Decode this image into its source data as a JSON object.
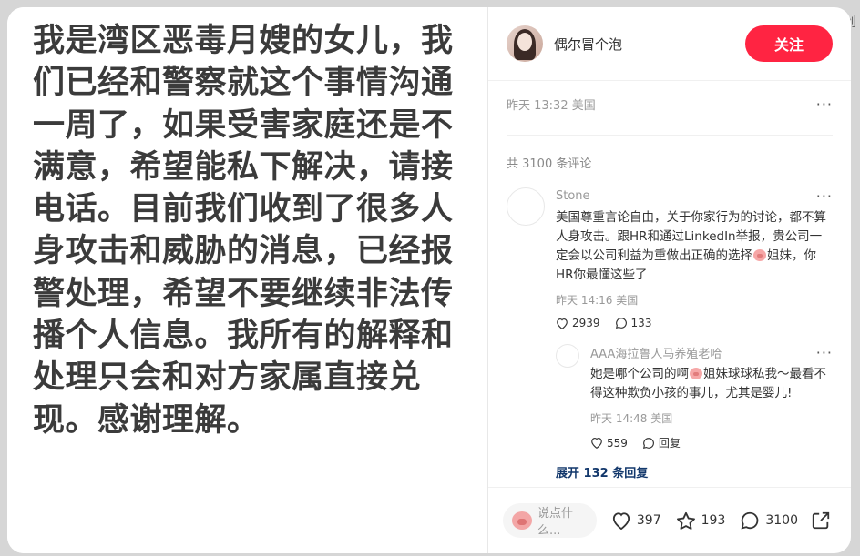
{
  "corner_text": "创",
  "post": {
    "body": "我是湾区恶毒月嫂的女儿，我们已经和警察就这个事情沟通一周了，如果受害家庭还是不满意，希望能私下解决，请接电话。目前我们收到了很多人身攻击和威胁的消息，已经报警处理，希望不要继续非法传播个人信息。我所有的解释和处理只会和对方家属直接兑现。感谢理解。"
  },
  "author": {
    "name": "偶尔冒个泡",
    "follow_label": "关注"
  },
  "meta": {
    "timestamp": "昨天 13:32 美国",
    "more": "···"
  },
  "comments_total": "共 3100 条评论",
  "comment": {
    "author": "Stone",
    "more": "···",
    "text_before": "美国尊重言论自由，关于你家行为的讨论，都不算人身攻击。跟HR和通过LinkedIn举报，贵公司一定会以公司利益为重做出正确的选择",
    "text_after": "姐妹，你HR你最懂这些了",
    "time": "昨天 14:16 美国",
    "likes": "2939",
    "replies": "133",
    "reply": {
      "author": "AAA海拉鲁人马养殖老哈",
      "more": "···",
      "text_before": "她是哪个公司的啊",
      "text_after": "姐妹球球私我～最看不得这种欺负小孩的事儿，尤其是婴儿!",
      "time": "昨天 14:48 美国",
      "likes": "559",
      "reply_label": "回复"
    },
    "expand_label": "展开 132 条回复"
  },
  "bottom": {
    "input_placeholder": "说点什么...",
    "likes": "397",
    "collects": "193",
    "comments": "3100"
  },
  "colors": {
    "accent": "#ff2442",
    "link": "#13386c"
  }
}
